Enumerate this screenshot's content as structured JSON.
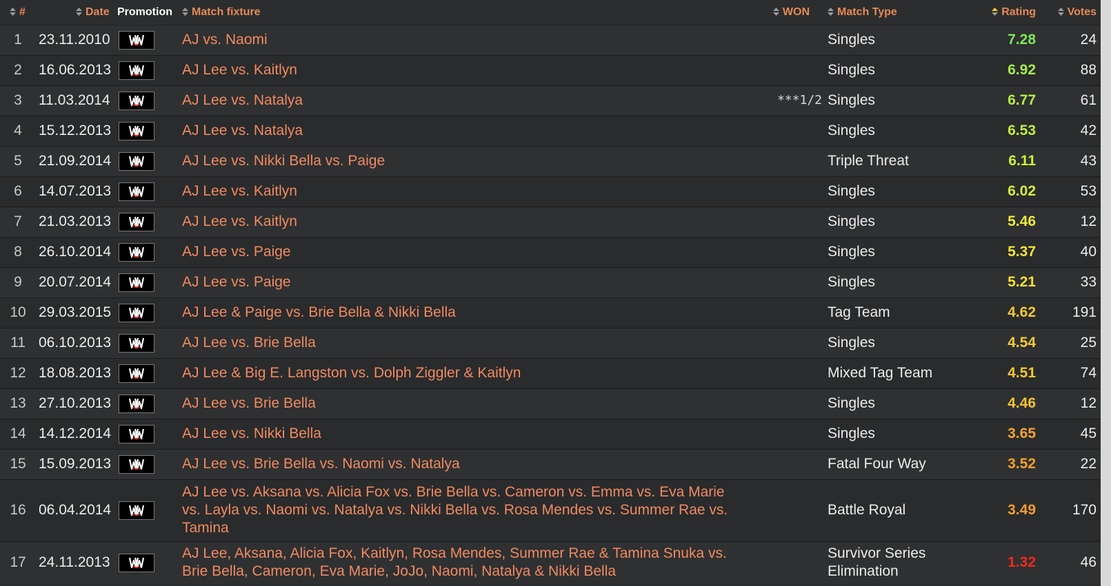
{
  "columns": {
    "num": "#",
    "date": "Date",
    "promotion": "Promotion",
    "fixture": "Match fixture",
    "won": "WON",
    "type": "Match Type",
    "rating": "Rating",
    "votes": "Votes"
  },
  "rating_colors": {
    "green": "#7de85a",
    "lime": "#c8f03c",
    "yellow": "#f3e43a",
    "gold": "#f8c62d",
    "orange": "#f8a02a",
    "red": "#f02a1e"
  },
  "promotion_logo": "wwe-logo-icon",
  "rows": [
    {
      "num": "1",
      "date": "23.11.2010",
      "fixture": "AJ vs. Naomi",
      "won": "",
      "type": "Singles",
      "rating": "7.28",
      "rating_color": "#7de85a",
      "votes": "24"
    },
    {
      "num": "2",
      "date": "16.06.2013",
      "fixture": "AJ Lee vs. Kaitlyn",
      "won": "",
      "type": "Singles",
      "rating": "6.92",
      "rating_color": "#a6ec4a",
      "votes": "88"
    },
    {
      "num": "3",
      "date": "11.03.2014",
      "fixture": "AJ Lee vs. Natalya",
      "won": "***1/2",
      "type": "Singles",
      "rating": "6.77",
      "rating_color": "#b4ee44",
      "votes": "61"
    },
    {
      "num": "4",
      "date": "15.12.2013",
      "fixture": "AJ Lee vs. Natalya",
      "won": "",
      "type": "Singles",
      "rating": "6.53",
      "rating_color": "#c2ef40",
      "votes": "42"
    },
    {
      "num": "5",
      "date": "21.09.2014",
      "fixture": "AJ Lee vs. Nikki Bella vs. Paige",
      "won": "",
      "type": "Triple Threat",
      "rating": "6.11",
      "rating_color": "#cfef3c",
      "votes": "43"
    },
    {
      "num": "6",
      "date": "14.07.2013",
      "fixture": "AJ Lee vs. Kaitlyn",
      "won": "",
      "type": "Singles",
      "rating": "6.02",
      "rating_color": "#d6ef3b",
      "votes": "53"
    },
    {
      "num": "7",
      "date": "21.03.2013",
      "fixture": "AJ Lee vs. Kaitlyn",
      "won": "",
      "type": "Singles",
      "rating": "5.46",
      "rating_color": "#eeea38",
      "votes": "12"
    },
    {
      "num": "8",
      "date": "26.10.2014",
      "fixture": "AJ Lee vs. Paige",
      "won": "",
      "type": "Singles",
      "rating": "5.37",
      "rating_color": "#f2e636",
      "votes": "40"
    },
    {
      "num": "9",
      "date": "20.07.2014",
      "fixture": "AJ Lee vs. Paige",
      "won": "",
      "type": "Singles",
      "rating": "5.21",
      "rating_color": "#f4e036",
      "votes": "33"
    },
    {
      "num": "10",
      "date": "29.03.2015",
      "fixture": "AJ Lee & Paige vs. Brie Bella & Nikki Bella",
      "won": "",
      "type": "Tag Team",
      "rating": "4.62",
      "rating_color": "#f7c92e",
      "votes": "191"
    },
    {
      "num": "11",
      "date": "06.10.2013",
      "fixture": "AJ Lee vs. Brie Bella",
      "won": "",
      "type": "Singles",
      "rating": "4.54",
      "rating_color": "#f7cb30",
      "votes": "25"
    },
    {
      "num": "12",
      "date": "18.08.2013",
      "fixture": "AJ Lee & Big E. Langston vs. Dolph Ziggler & Kaitlyn",
      "won": "",
      "type": "Mixed Tag Team",
      "rating": "4.51",
      "rating_color": "#f7c830",
      "votes": "74"
    },
    {
      "num": "13",
      "date": "27.10.2013",
      "fixture": "AJ Lee vs. Brie Bella",
      "won": "",
      "type": "Singles",
      "rating": "4.46",
      "rating_color": "#f8c42e",
      "votes": "12"
    },
    {
      "num": "14",
      "date": "14.12.2014",
      "fixture": "AJ Lee vs. Nikki Bella",
      "won": "",
      "type": "Singles",
      "rating": "3.65",
      "rating_color": "#f8a42a",
      "votes": "45"
    },
    {
      "num": "15",
      "date": "15.09.2013",
      "fixture": "AJ Lee vs. Brie Bella vs. Naomi vs. Natalya",
      "won": "",
      "type": "Fatal Four Way",
      "rating": "3.52",
      "rating_color": "#f8a02a",
      "votes": "22"
    },
    {
      "num": "16",
      "date": "06.04.2014",
      "fixture": "AJ Lee vs. Aksana vs. Alicia Fox vs. Brie Bella vs. Cameron vs. Emma vs. Eva Marie vs. Layla vs. Naomi vs. Natalya vs. Nikki Bella vs. Rosa Mendes vs. Summer Rae vs. Tamina",
      "won": "",
      "type": "Battle Royal",
      "rating": "3.49",
      "rating_color": "#f89e2a",
      "votes": "170"
    },
    {
      "num": "17",
      "date": "24.11.2013",
      "fixture": "AJ Lee, Aksana, Alicia Fox, Kaitlyn, Rosa Mendes, Summer Rae & Tamina Snuka vs. Brie Bella, Cameron, Eva Marie, JoJo, Naomi, Natalya & Nikki Bella",
      "won": "",
      "type": "Survivor Series Elimination",
      "rating": "1.32",
      "rating_color": "#f02a1e",
      "votes": "46"
    }
  ]
}
